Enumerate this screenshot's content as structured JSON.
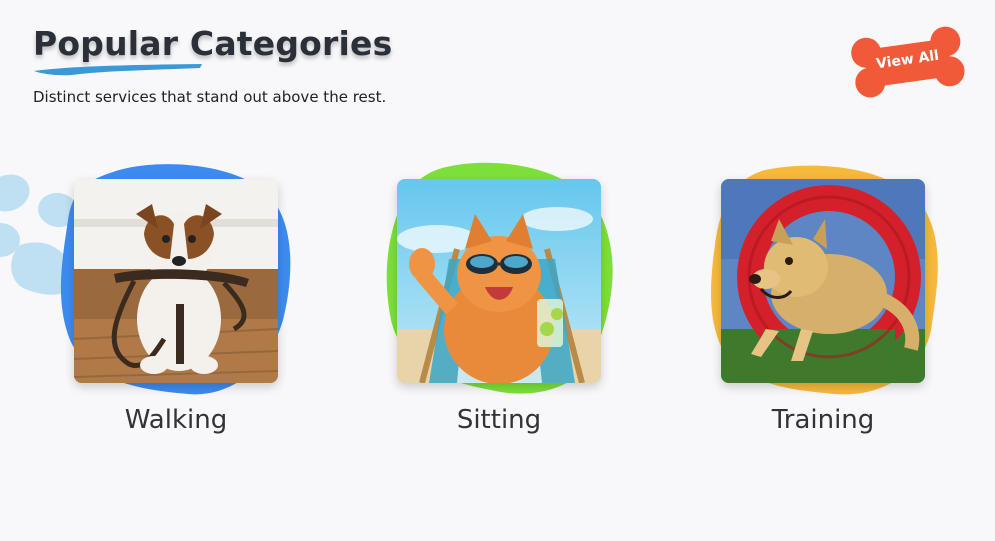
{
  "header": {
    "title": "Popular Categories",
    "subtitle": "Distinct services that stand out above the rest.",
    "view_all_label": "View All"
  },
  "colors": {
    "title": "#2a2f38",
    "underline": "#3a9ad9",
    "bone_button": "#f05a38",
    "paw": "#bfe0f2",
    "walking_blob": "#3d8bf0",
    "sitting_blob": "#7de03a",
    "training_blob": "#f6b93b"
  },
  "categories": [
    {
      "label": "Walking",
      "image": "dog-with-leash-image"
    },
    {
      "label": "Sitting",
      "image": "cat-with-sunglasses-image"
    },
    {
      "label": "Training",
      "image": "dog-jumping-through-ring-image"
    }
  ]
}
